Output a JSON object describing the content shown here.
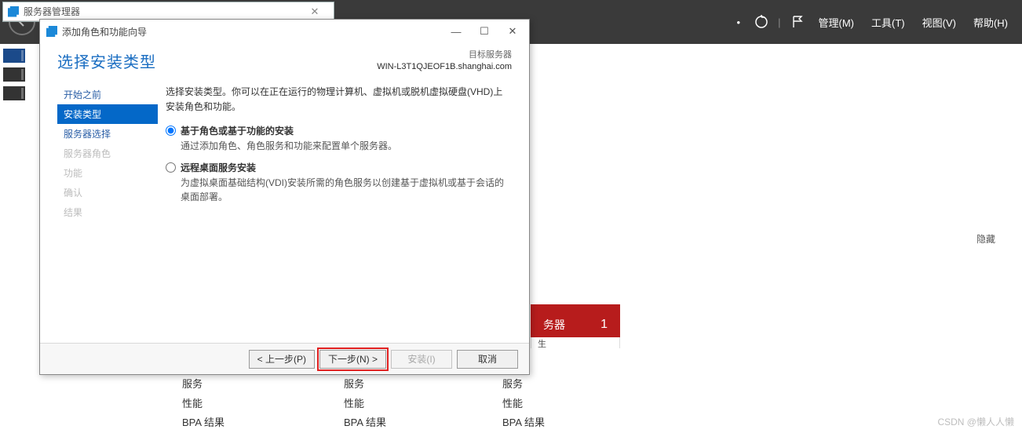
{
  "top_bar": {
    "menu_manage": "管理(M)",
    "menu_tools": "工具(T)",
    "menu_view": "视图(V)",
    "menu_help": "帮助(H)",
    "bullet": "•"
  },
  "parent_window": {
    "title": "服务器管理器"
  },
  "wizard": {
    "title": "添加角色和功能向导",
    "heading": "选择安装类型",
    "dest_label": "目标服务器",
    "dest_server": "WIN-L3T1QJEOF1B.shanghai.com",
    "intro": "选择安装类型。你可以在正在运行的物理计算机、虚拟机或脱机虚拟硬盘(VHD)上安装角色和功能。",
    "steps": [
      {
        "label": "开始之前",
        "state": "enabled"
      },
      {
        "label": "安装类型",
        "state": "active"
      },
      {
        "label": "服务器选择",
        "state": "enabled"
      },
      {
        "label": "服务器角色",
        "state": "disabled"
      },
      {
        "label": "功能",
        "state": "disabled"
      },
      {
        "label": "确认",
        "state": "disabled"
      },
      {
        "label": "结果",
        "state": "disabled"
      }
    ],
    "options": [
      {
        "title": "基于角色或基于功能的安装",
        "desc": "通过添加角色、角色服务和功能来配置单个服务器。",
        "checked": true
      },
      {
        "title": "远程桌面服务安装",
        "desc": "为虚拟桌面基础结构(VDI)安装所需的角色服务以创建基于虚拟机或基于会话的桌面部署。",
        "checked": false
      }
    ],
    "buttons": {
      "prev": "< 上一步(P)",
      "next": "下一步(N) >",
      "install": "安装(I)",
      "cancel": "取消"
    },
    "win_controls": {
      "min": "—",
      "max": "☐",
      "close": "✕"
    }
  },
  "background": {
    "hide": "隐藏",
    "red_tile_label": "务器",
    "red_tile_count": "1",
    "red_stub": "生",
    "columns": {
      "row1": "服务",
      "row2": "性能",
      "row3": "BPA 结果"
    }
  },
  "watermark": "CSDN @懒人人懒"
}
